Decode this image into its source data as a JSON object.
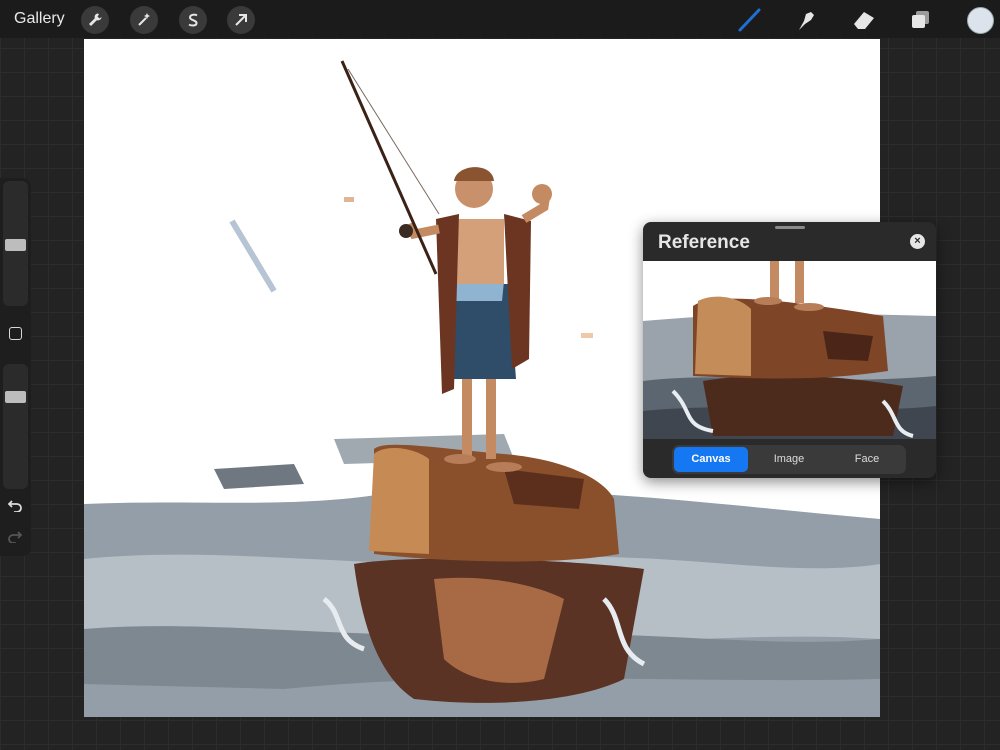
{
  "topbar": {
    "gallery_label": "Gallery",
    "left_tools": [
      "wrench-icon",
      "magic-wand-icon",
      "selection-s-icon",
      "transform-arrow-icon"
    ],
    "right_tools": [
      "brush-icon",
      "smudge-icon",
      "eraser-icon",
      "layers-icon"
    ],
    "brush_color": "#1f6fd6",
    "current_color": "#dde3ec"
  },
  "sidebar": {
    "brush_size_level": 0.5,
    "opacity_level": 0.75,
    "undo_icon": "undo-arrow-icon",
    "redo_icon": "redo-arrow-icon"
  },
  "reference": {
    "title": "Reference",
    "tabs": [
      {
        "label": "Canvas",
        "active": true
      },
      {
        "label": "Image",
        "active": false
      },
      {
        "label": "Face",
        "active": false
      }
    ]
  },
  "colors": {
    "accent": "#1677f2",
    "toolbar": "#1b1b1b",
    "panel": "#2a2a2a"
  }
}
